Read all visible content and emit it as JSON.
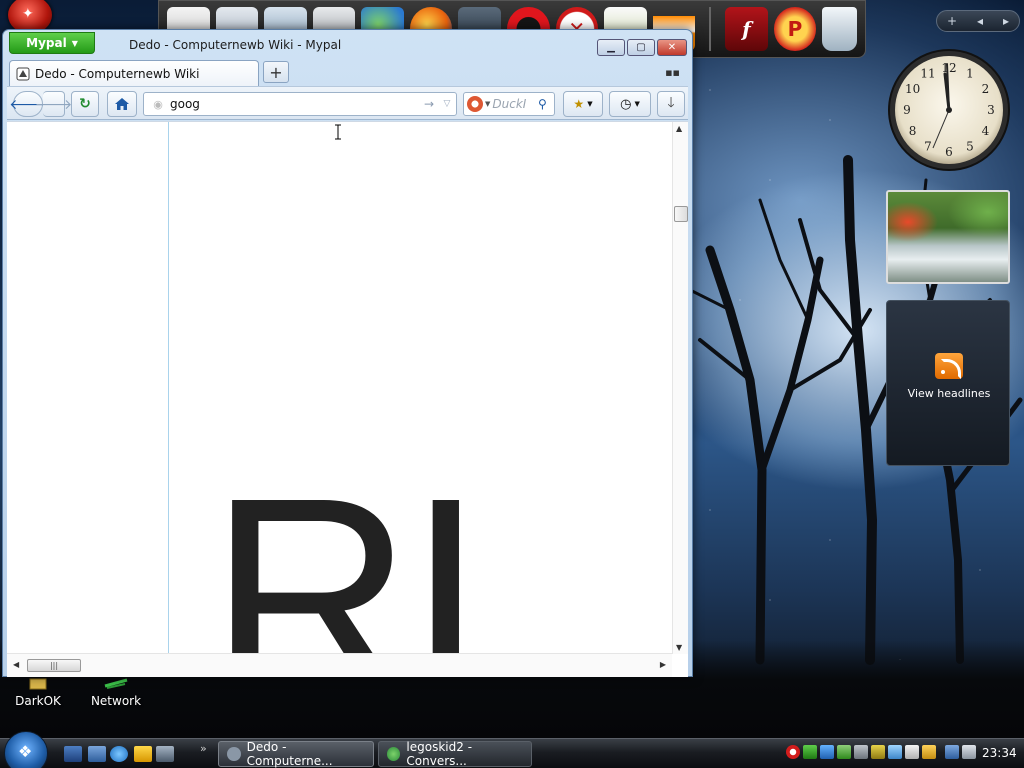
{
  "desktop": {
    "icons": [
      {
        "label": "DarkOK",
        "icon": "folder-icon"
      },
      {
        "label": "Network",
        "icon": "network-icon"
      }
    ],
    "feed_gadget": {
      "label": "View headlines"
    },
    "clock_gadget": {
      "time": "11:59",
      "numbers": [
        "12",
        "1",
        "2",
        "3",
        "4",
        "5",
        "6",
        "7",
        "8",
        "9",
        "10",
        "11"
      ]
    }
  },
  "dock": {
    "items": [
      "notepad-icon",
      "tools-icon",
      "control-panel-icon",
      "settings-icon",
      "messenger-icon",
      "firefox-icon",
      "fox-icon",
      "opera-icon",
      "x-icon",
      "document-icon",
      "vlc-icon",
      "flash-icon",
      "p-icon",
      "recycle-bin-icon"
    ]
  },
  "window": {
    "app_menu_label": "Mypal",
    "title": "Dedo - Computernewb Wiki - Mypal",
    "tab": {
      "label": "Dedo - Computernewb Wiki"
    },
    "new_tab_label": "+",
    "url": {
      "value": "goog"
    },
    "search": {
      "placeholder": "DuckI"
    },
    "page": {
      "logo_text": "RI"
    }
  },
  "taskbar": {
    "tasks": [
      {
        "label": "Dedo - Computerne..."
      },
      {
        "label": "legoskid2 - Convers..."
      }
    ],
    "clock": "23:34"
  },
  "colors": {
    "app_button": "#239a17",
    "close_button": "#c0392b",
    "rss": "#f08a1c",
    "start_orb": "#1f5ea8"
  }
}
